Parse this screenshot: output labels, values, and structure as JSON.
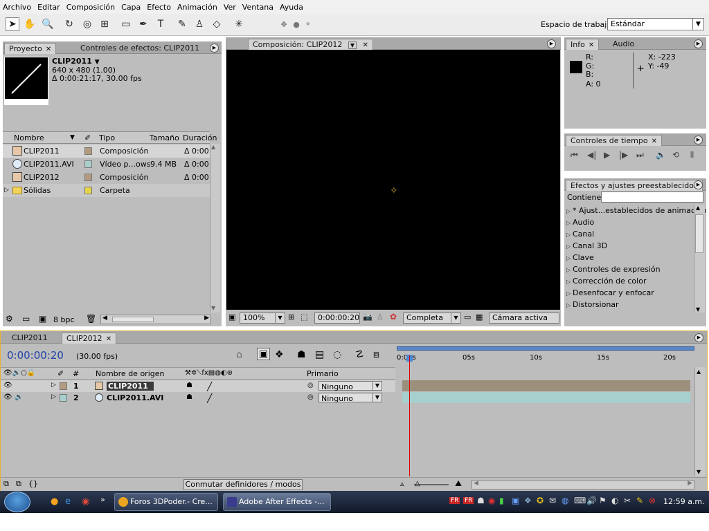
{
  "menu": [
    "Archivo",
    "Editar",
    "Composición",
    "Capa",
    "Efecto",
    "Animación",
    "Ver",
    "Ventana",
    "Ayuda"
  ],
  "toolbar": {
    "workspace_label": "Espacio de trabajo",
    "workspace_value": "Estándar",
    "tools": [
      "selection-tool",
      "hand-tool",
      "zoom-tool",
      "rotate-tool",
      "camera-orbit-tool",
      "pan-behind-tool",
      "rectangle-tool",
      "pen-tool",
      "text-tool",
      "brush-tool",
      "clone-stamp-tool",
      "eraser-tool",
      "puppet-tool"
    ]
  },
  "project": {
    "tab_label": "Proyecto",
    "effects_tab_label": "Controles de efectos: CLIP2011",
    "selected_name": "CLIP2011",
    "selected_size": "640 x 480 (1.00)",
    "selected_duration": "Δ 0:00:21:17, 30.00 fps",
    "columns": {
      "name": "Nombre",
      "type": "Tipo",
      "size": "Tamaño",
      "duration": "Duración"
    },
    "items": [
      {
        "name": "CLIP2011",
        "type": "Composición",
        "size": "",
        "duration": "Δ 0:00:",
        "swatch": "#b39a80",
        "selected": true
      },
      {
        "name": "CLIP2011.AVI",
        "type": "Vídeo p...ows",
        "size": "9.4 MB",
        "duration": "Δ 0:00:",
        "swatch": "#a7cfcd",
        "selected": false
      },
      {
        "name": "CLIP2012",
        "type": "Composición",
        "size": "",
        "duration": "Δ 0:00:",
        "swatch": "#b39a80",
        "selected": false
      },
      {
        "name": "Sólidas",
        "type": "Carpeta",
        "size": "",
        "duration": "",
        "swatch": "#e6d54a",
        "selected": false
      }
    ],
    "bpc": "8 bpc"
  },
  "composition": {
    "tab_label": "Composición: CLIP2012",
    "zoom": "100%",
    "timecode": "0:00:00:20",
    "resolution": "Completa",
    "camera": "Cámara activa"
  },
  "info": {
    "tab_label": "Info",
    "audio_tab_label": "Audio",
    "r": "R:",
    "g": "G:",
    "b": "B:",
    "a": "A:  0",
    "x": "X:  -223",
    "y": "Y:  -49"
  },
  "time_controls": {
    "tab_label": "Controles de tiempo"
  },
  "effects": {
    "tab_label": "Efectos y ajustes preestablecidos",
    "contains_label": "Contiene:",
    "contains_value": "",
    "items": [
      "* Ajust...establecidos de animación",
      "Audio",
      "Canal",
      "Canal 3D",
      "Clave",
      "Controles de expresión",
      "Corrección de color",
      "Desenfocar y enfocar",
      "Distorsionar"
    ]
  },
  "timeline": {
    "tabs": [
      "CLIP2011",
      "CLIP2012"
    ],
    "current_time": "0:00:00:20",
    "fps": "(30.00 fps)",
    "col_number": "#",
    "col_source": "Nombre de origen",
    "col_parent": "Primario",
    "ruler": [
      "0:00s",
      "05s",
      "10s",
      "15s",
      "20s"
    ],
    "layers": [
      {
        "index": "1",
        "name": "CLIP2011",
        "parent": "Ninguno",
        "swatch": "#b39a80"
      },
      {
        "index": "2",
        "name": "CLIP2011.AVI",
        "parent": "Ninguno",
        "swatch": "#a7cfcd"
      }
    ],
    "switch_label": "Conmutar definidores / modos"
  },
  "taskbar": {
    "items": [
      {
        "label": "Foros 3DPoder.- Cre...",
        "icon_color": "#e8a51d"
      },
      {
        "label": "Adobe After Effects -...",
        "icon_color": "#3a3c8e"
      }
    ],
    "clock": "12:59 a.m."
  }
}
